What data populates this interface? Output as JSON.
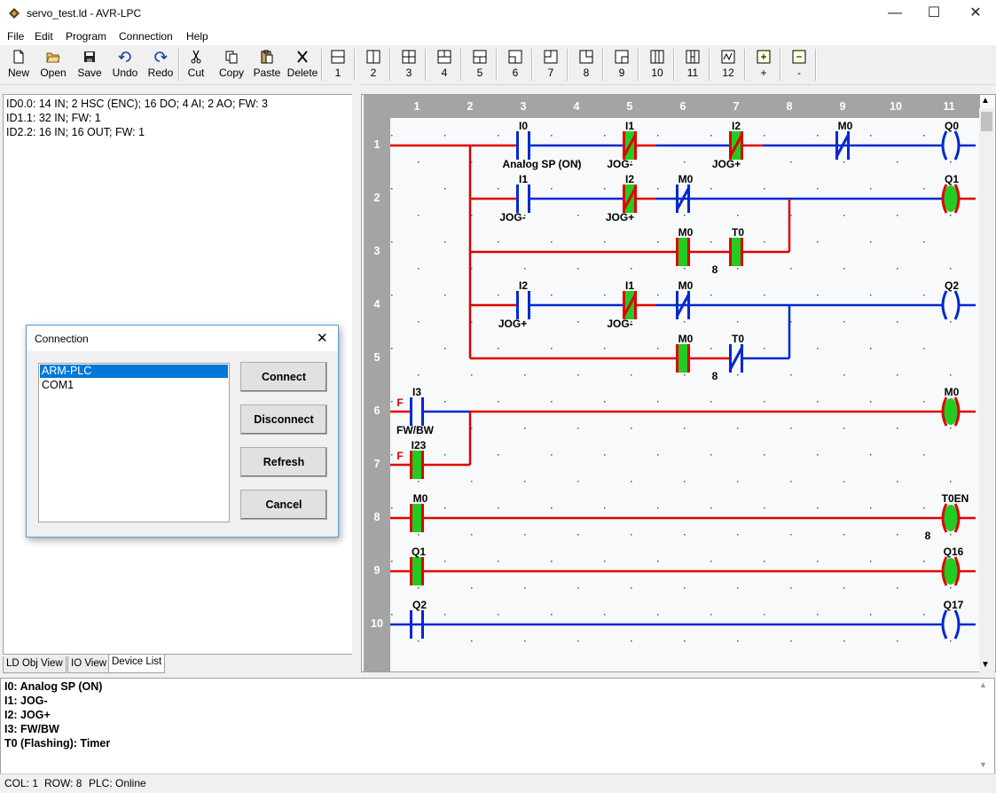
{
  "window": {
    "title": "servo_test.ld  - AVR-LPC",
    "minimize": "—",
    "maximize": "☐",
    "close": "✕"
  },
  "menu": [
    "File",
    "Edit",
    "Program",
    "Connection",
    "Help"
  ],
  "toolbar": {
    "new": "New",
    "open": "Open",
    "save": "Save",
    "undo": "Undo",
    "redo": "Redo",
    "cut": "Cut",
    "copy": "Copy",
    "paste": "Paste",
    "delete": "Delete",
    "grid": [
      "1",
      "2",
      "3",
      "4",
      "5",
      "6",
      "7",
      "8",
      "9",
      "10",
      "11",
      "12",
      "+",
      "-"
    ]
  },
  "device_list": [
    "ID0.0: 14 IN; 2 HSC (ENC); 16 DO; 4 AI; 2 AO; FW: 3",
    "ID1.1: 32 IN; FW: 1",
    "ID2.2: 16 IN; 16 OUT; FW: 1"
  ],
  "tabs": [
    "LD Obj View",
    "IO View",
    "Device List"
  ],
  "ladder": {
    "columns": [
      "1",
      "2",
      "3",
      "4",
      "5",
      "6",
      "7",
      "8",
      "9",
      "10",
      "11"
    ],
    "rows": [
      "1",
      "2",
      "3",
      "4",
      "5",
      "6",
      "7",
      "8",
      "9",
      "10"
    ],
    "labels": {
      "r1_i0": "I0",
      "r1_i0_sub": "Analog SP (ON)",
      "r1_i1": "I1",
      "r1_i1_sub": "JOG-",
      "r1_i2": "I2",
      "r1_i2_sub": "JOG+",
      "r1_m0": "M0",
      "r1_q0": "Q0",
      "r2_i1": "I1",
      "r2_i1_sub": "JOG-",
      "r2_i2": "I2",
      "r2_i2_sub": "JOG+",
      "r2_m0": "M0",
      "r2_q1": "Q1",
      "r3_m0": "M0",
      "r3_t0": "T0",
      "r3_val": "8",
      "r4_i2": "I2",
      "r4_i2_sub": "JOG+",
      "r4_i1": "I1",
      "r4_i1_sub": "JOG-",
      "r4_m0": "M0",
      "r4_q2": "Q2",
      "r5_m0": "M0",
      "r5_t0": "T0",
      "r5_val": "8",
      "r6_f": "F",
      "r6_i3": "I3",
      "r6_i3_sub": "FW/BW",
      "r6_m0": "M0",
      "r7_f": "F",
      "r7_i23": "I23",
      "r8_m0": "M0",
      "r8_t0en": "T0EN",
      "r8_val": "8",
      "r9_q1": "Q1",
      "r9_q16": "Q16",
      "r10_q2": "Q2",
      "r10_q17": "Q17"
    }
  },
  "symbols": [
    "I0: Analog SP (ON)",
    "I1: JOG-",
    "I2: JOG+",
    "I3: FW/BW",
    "T0 (Flashing): Timer"
  ],
  "status": {
    "col": "COL: 1",
    "row": "ROW: 8",
    "plc": "PLC: Online"
  },
  "dialog": {
    "title": "Connection",
    "close": "✕",
    "items": [
      "ARM-PLC",
      "COM1"
    ],
    "buttons": {
      "connect": "Connect",
      "disconnect": "Disconnect",
      "refresh": "Refresh",
      "cancel": "Cancel"
    }
  },
  "colors": {
    "energized": "#e00000",
    "deenergized": "#0028d0",
    "active_fill": "#22cc22",
    "grid_header": "#a4a4a4"
  }
}
